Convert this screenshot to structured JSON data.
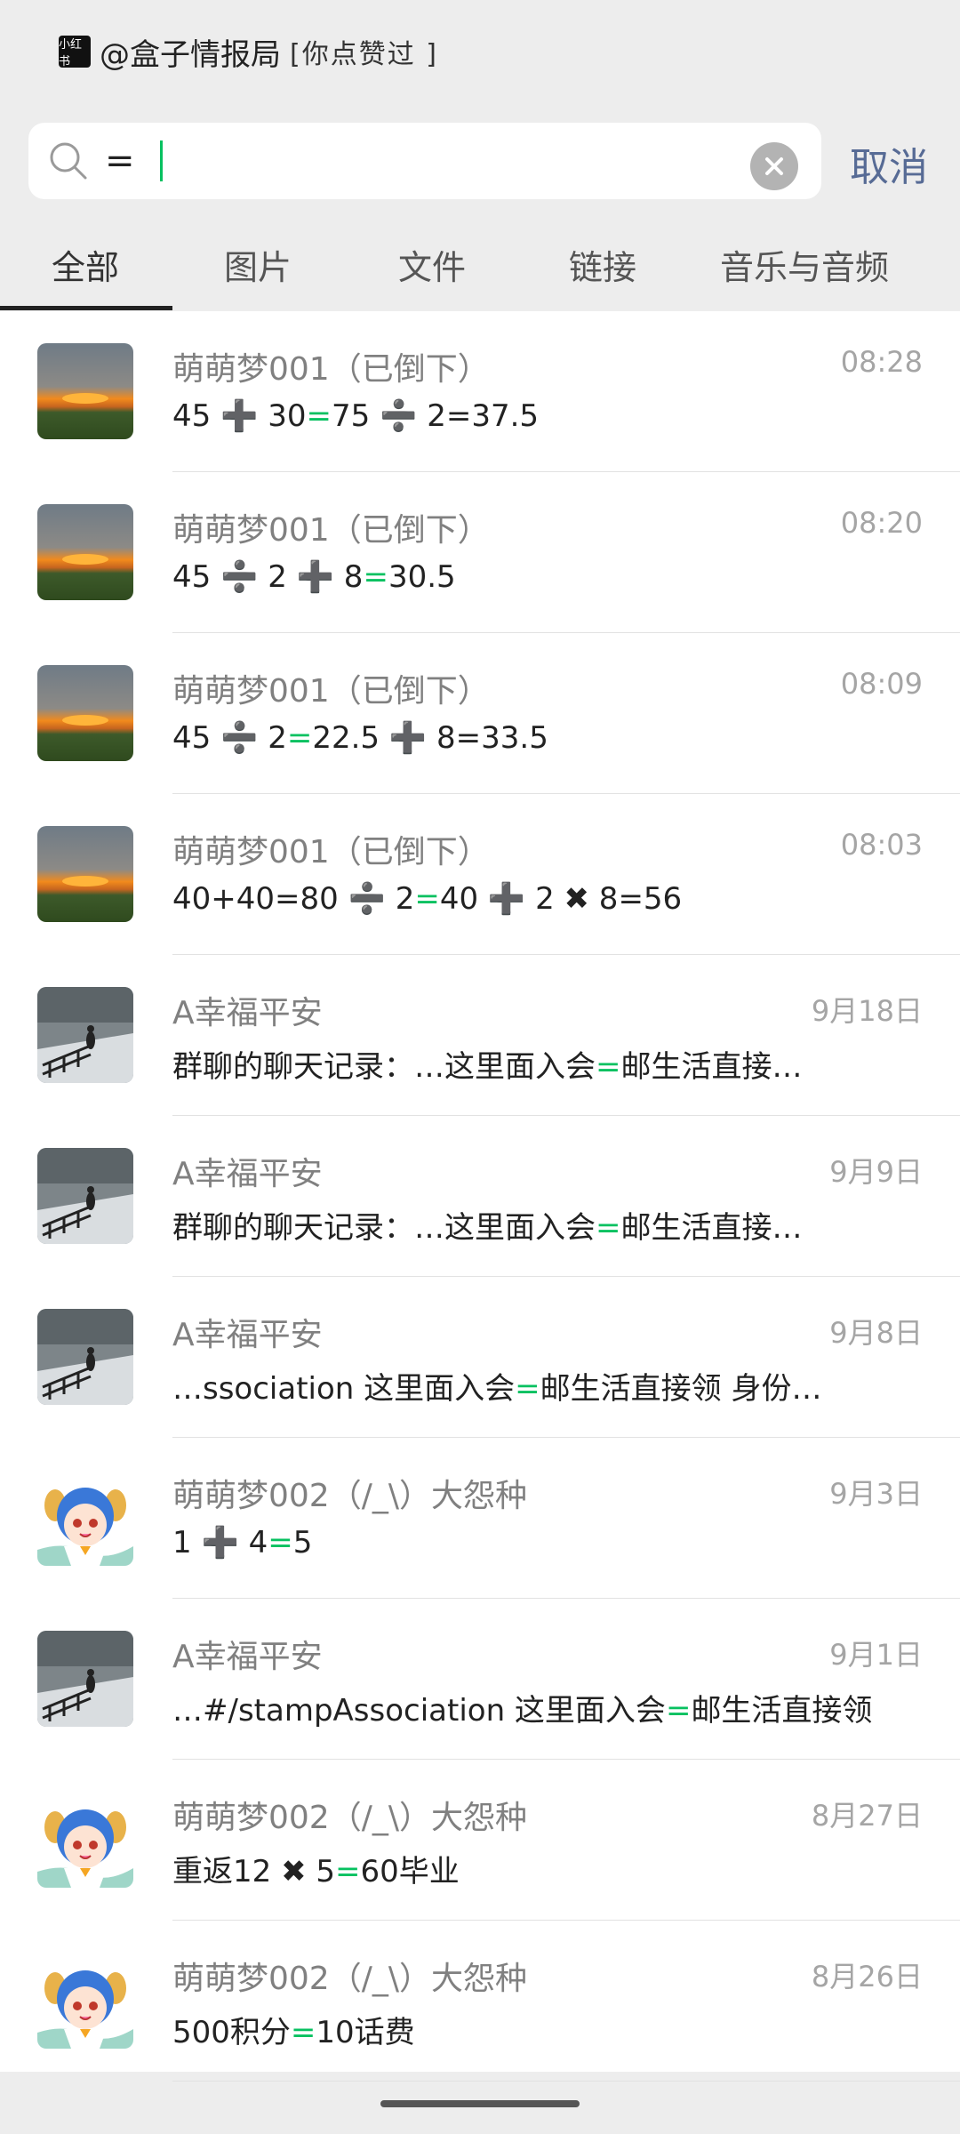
{
  "top_chip": {
    "logo": "小红书",
    "text": "@盒子情报局",
    "bracket": "[你点赞过        ]"
  },
  "search": {
    "query": "=",
    "cancel_label": "取消"
  },
  "tabs": [
    {
      "label": "全部",
      "active": true
    },
    {
      "label": "图片",
      "active": false
    },
    {
      "label": "文件",
      "active": false
    },
    {
      "label": "链接",
      "active": false
    },
    {
      "label": "音乐与音频",
      "active": false
    }
  ],
  "results": [
    {
      "avatar": "sunset",
      "name": "萌萌梦001（已倒下）",
      "time": "08:28",
      "msg_before": "45 ➕ 30",
      "msg_highlight": "=",
      "msg_after": "75 ➗ 2=37.5"
    },
    {
      "avatar": "sunset",
      "name": "萌萌梦001（已倒下）",
      "time": "08:20",
      "msg_before": "45 ➗ 2 ➕ 8",
      "msg_highlight": "=",
      "msg_after": "30.5"
    },
    {
      "avatar": "sunset",
      "name": "萌萌梦001（已倒下）",
      "time": "08:09",
      "msg_before": "45 ➗ 2",
      "msg_highlight": "=",
      "msg_after": "22.5 ➕ 8=33.5"
    },
    {
      "avatar": "sunset",
      "name": "萌萌梦001（已倒下）",
      "time": "08:03",
      "msg_before": "40+40=80 ➗ 2",
      "msg_highlight": "=",
      "msg_after": "40 ➕ 2 ✖ 8=56"
    },
    {
      "avatar": "snow",
      "name": "A幸福平安",
      "time": "9月18日",
      "msg_before": "群聊的聊天记录：…这里面入会",
      "msg_highlight": "=",
      "msg_after": "邮生活直接…"
    },
    {
      "avatar": "snow",
      "name": "A幸福平安",
      "time": "9月9日",
      "msg_before": "群聊的聊天记录：…这里面入会",
      "msg_highlight": "=",
      "msg_after": "邮生活直接…"
    },
    {
      "avatar": "snow",
      "name": "A幸福平安",
      "time": "9月8日",
      "msg_before": "…ssociation 这里面入会",
      "msg_highlight": "=",
      "msg_after": "邮生活直接领 身份…"
    },
    {
      "avatar": "anime",
      "name": "萌萌梦002（/_\\）大怨种",
      "time": "9月3日",
      "msg_before": "1 ➕ 4",
      "msg_highlight": "=",
      "msg_after": "5"
    },
    {
      "avatar": "snow",
      "name": "A幸福平安",
      "time": "9月1日",
      "msg_before": "…#/stampAssociation 这里面入会",
      "msg_highlight": "=",
      "msg_after": "邮生活直接领"
    },
    {
      "avatar": "anime",
      "name": "萌萌梦002（/_\\）大怨种",
      "time": "8月27日",
      "msg_before": "重返12 ✖ 5",
      "msg_highlight": "=",
      "msg_after": "60毕业"
    },
    {
      "avatar": "anime",
      "name": "萌萌梦002（/_\\）大怨种",
      "time": "8月26日",
      "msg_before": "500积分",
      "msg_highlight": "=",
      "msg_after": "10话费"
    }
  ]
}
